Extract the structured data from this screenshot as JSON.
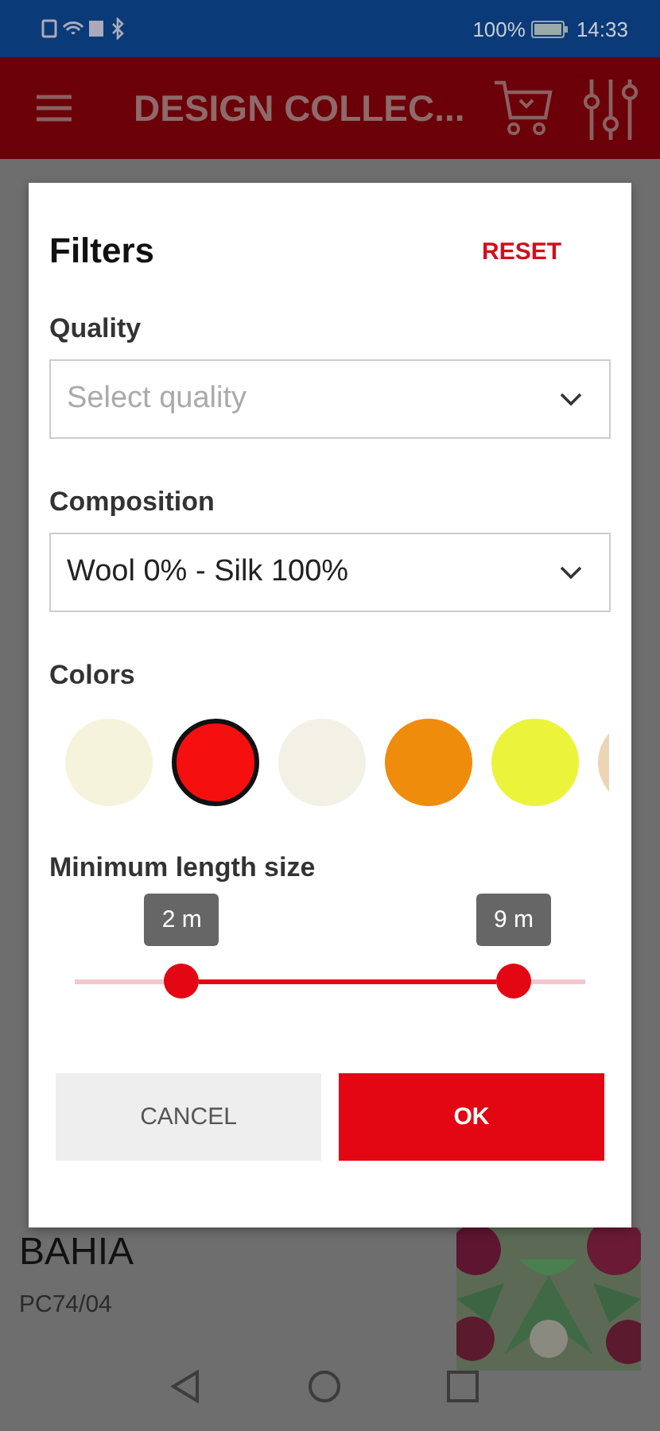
{
  "status_bar": {
    "battery": "100%",
    "time": "14:33"
  },
  "toolbar": {
    "title": "DESIGN COLLEC..."
  },
  "background_item": {
    "name": "BAHIA",
    "code": "PC74/04"
  },
  "dialog": {
    "title": "Filters",
    "reset": "RESET",
    "fields": [
      {
        "label": "Quality",
        "placeholder": "Select quality"
      },
      {
        "label": "Composition",
        "value": "Wool 0% - Silk 100%"
      }
    ],
    "colors_label": "Colors",
    "colors": [
      {
        "color": "#f6f3dc",
        "selected": false
      },
      {
        "color": "#f5100f",
        "selected": true
      },
      {
        "color": "#f3f0e6",
        "selected": false
      },
      {
        "color": "#ef8c0c",
        "selected": false
      },
      {
        "color": "#ebf43b",
        "selected": false
      },
      {
        "color": "#ecd5b5",
        "selected": false
      }
    ],
    "slider": {
      "label": "Minimum length size",
      "handles": [
        {
          "label": "2 m",
          "level": 0.21
        },
        {
          "label": "9 m",
          "level": 0.86
        }
      ]
    },
    "buttons": [
      {
        "kind": "secondary",
        "label": "CANCEL"
      },
      {
        "kind": "primary",
        "label": "OK"
      }
    ]
  }
}
